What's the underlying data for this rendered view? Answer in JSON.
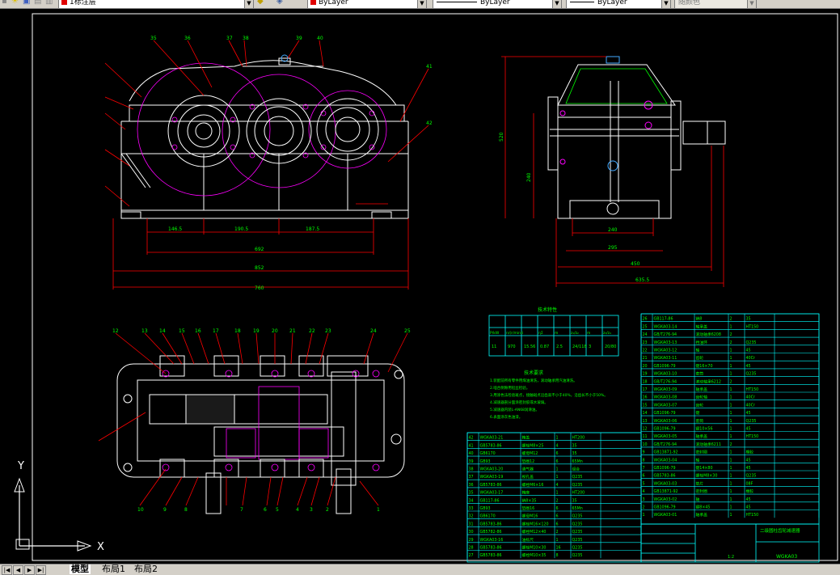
{
  "toolbar": {
    "layer_name": "1标注层",
    "color_control": "ByLayer",
    "linetype_control": "ByLayer",
    "lineweight_control": "ByLayer",
    "plotstyle_control": "随颜色",
    "colors": {
      "layer_swatch": "#e00000",
      "color_swatch": "#e00000"
    }
  },
  "dimensions": {
    "d1": "146.5",
    "d2": "190.5",
    "d3": "187.5",
    "overall_1": "692",
    "overall_2": "852",
    "overall_3": "760",
    "side_w1": "240",
    "side_w2": "295",
    "side_w3": "450",
    "side_w4": "635.5",
    "height_1": "240",
    "height_2": "520"
  },
  "balloons_top": [
    "12",
    "13",
    "14",
    "15",
    "16",
    "17",
    "18",
    "19",
    "20",
    "21",
    "22",
    "23",
    "24",
    "25"
  ],
  "balloons_bottom": [
    "10",
    "9",
    "8",
    "7",
    "6",
    "5",
    "4",
    "3",
    "2",
    "1"
  ],
  "balloons_front": [
    "35",
    "36",
    "37",
    "38",
    "39",
    "40",
    "41",
    "42"
  ],
  "tech_title": "技术特性",
  "req_title": "技术要求",
  "tech_table": {
    "head": [
      "P/kW",
      "n/(r/min)",
      "i",
      "ηΣ",
      "m",
      "z₁/z₂",
      "m",
      "z₃/z₄"
    ],
    "row": [
      "11",
      "970",
      "15.56",
      "0.87",
      "2.5",
      "24/118",
      "3",
      "20/80"
    ]
  },
  "requirements": [
    "1.装配前所有零件用煤油清洗，滚动轴承用汽油清洗。",
    "2.啮合侧隙用铅丝检验。",
    "3.用涂色法检验斑点，接触斑点沿齿高不小于40%，沿齿长不小于50%。",
    "4.减速器剖分面涂密封胶或水玻璃。",
    "5.减速器内装L-AN68润滑油。",
    "6.表面涂灰色油漆。"
  ],
  "title_block": {
    "title": "二级圆柱齿轮减速器",
    "drawing_no": "WGKA03",
    "scale": "1:2"
  },
  "parts_left": [
    [
      "42",
      "WGKA03-21",
      "箱盖",
      "1",
      "HT200"
    ],
    [
      "41",
      "GB5783-86",
      "螺栓M8×25",
      "4",
      "35"
    ],
    [
      "40",
      "GB6170",
      "螺母M12",
      "6",
      "35"
    ],
    [
      "39",
      "GB93",
      "垫圈12",
      "6",
      "65Mn"
    ],
    [
      "38",
      "WGKA03-20",
      "通气器",
      "1",
      "组合"
    ],
    [
      "37",
      "WGKA03-19",
      "视孔盖",
      "1",
      "Q235"
    ],
    [
      "36",
      "GB5783-86",
      "螺栓M6×16",
      "4",
      "Q235"
    ],
    [
      "35",
      "WGKA03-17",
      "箱座",
      "1",
      "HT200"
    ],
    [
      "34",
      "GB117-86",
      "销8×35",
      "2",
      "35"
    ],
    [
      "33",
      "GB93",
      "垫圈16",
      "6",
      "65Mn"
    ],
    [
      "32",
      "GB6170",
      "螺母M16",
      "6",
      "Q235"
    ],
    [
      "31",
      "GB5783-86",
      "螺栓M16×120",
      "6",
      "Q235"
    ],
    [
      "30",
      "GB5782-86",
      "螺栓M12×40",
      "2",
      "Q235"
    ],
    [
      "29",
      "WGKA03-16",
      "油标尺",
      "1",
      "Q235"
    ],
    [
      "28",
      "GB5783-86",
      "螺栓M10×30",
      "16",
      "Q235"
    ],
    [
      "27",
      "GB5783-86",
      "螺栓M10×35",
      "8",
      "Q235"
    ]
  ],
  "parts_right": [
    [
      "26",
      "GB117-86",
      "销8",
      "2",
      "35"
    ],
    [
      "25",
      "WGKA03-14",
      "轴承盖",
      "1",
      "HT150"
    ],
    [
      "24",
      "GB/T276-94",
      "滚动轴承6208",
      "2",
      ""
    ],
    [
      "23",
      "WGKA03-13",
      "挡油环",
      "2",
      "Q235"
    ],
    [
      "22",
      "WGKA03-12",
      "轴",
      "1",
      "45"
    ],
    [
      "21",
      "WGKA03-11",
      "齿轮",
      "1",
      "40Cr"
    ],
    [
      "20",
      "GB1096-79",
      "键16×70",
      "1",
      "45"
    ],
    [
      "19",
      "WGKA03-10",
      "套筒",
      "1",
      "Q235"
    ],
    [
      "18",
      "GB/T276-94",
      "滚动轴承6212",
      "2",
      ""
    ],
    [
      "17",
      "WGKA03-09",
      "轴承盖",
      "1",
      "HT150"
    ],
    [
      "16",
      "WGKA03-08",
      "齿轮轴",
      "1",
      "40Cr"
    ],
    [
      "15",
      "WGKA03-07",
      "齿轮",
      "1",
      "40Cr"
    ],
    [
      "14",
      "GB1096-79",
      "键",
      "1",
      "45"
    ],
    [
      "13",
      "WGKA03-06",
      "套筒",
      "1",
      "Q235"
    ],
    [
      "12",
      "GB1096-79",
      "键10×56",
      "1",
      "45"
    ],
    [
      "11",
      "WGKA03-05",
      "轴承盖",
      "1",
      "HT150"
    ],
    [
      "10",
      "GB/T276-94",
      "滚动轴承6211",
      "2",
      ""
    ],
    [
      "9",
      "GB13871-92",
      "密封圈",
      "1",
      "橡胶"
    ],
    [
      "8",
      "WGKA03-04",
      "轴",
      "1",
      "45"
    ],
    [
      "7",
      "GB1096-79",
      "键14×80",
      "1",
      "45"
    ],
    [
      "6",
      "GB5783-86",
      "螺栓M8×30",
      "1",
      "Q235"
    ],
    [
      "5",
      "WGKA03-03",
      "垫片",
      "1",
      "08F"
    ],
    [
      "4",
      "GB13871-92",
      "密封圈",
      "1",
      "橡胶"
    ],
    [
      "3",
      "WGKA03-02",
      "轴",
      "1",
      "45"
    ],
    [
      "2",
      "GB1096-79",
      "键8×45",
      "1",
      "45"
    ],
    [
      "1",
      "WGKA03-01",
      "轴承盖",
      "1",
      "HT150"
    ]
  ],
  "tabs": [
    "模型",
    "布局1",
    "布局2"
  ],
  "ucs": {
    "x": "X",
    "y": "Y"
  }
}
